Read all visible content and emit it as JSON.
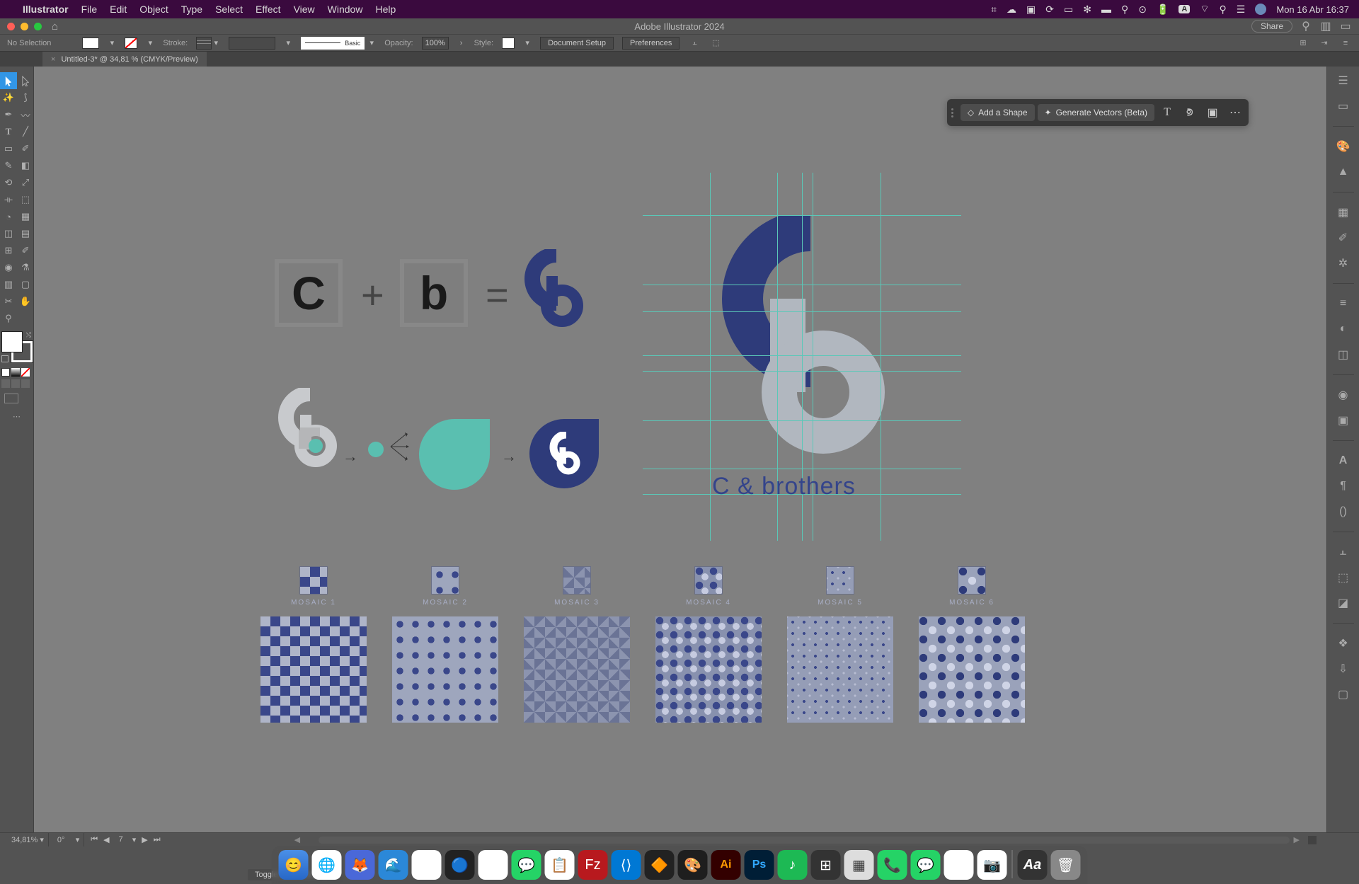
{
  "macos": {
    "app_name": "Illustrator",
    "menus": [
      "File",
      "Edit",
      "Object",
      "Type",
      "Select",
      "Effect",
      "View",
      "Window",
      "Help"
    ],
    "clock": "Mon 16 Abr  16:37"
  },
  "window": {
    "title": "Adobe Illustrator 2024",
    "share_label": "Share"
  },
  "control": {
    "selection_status": "No Selection",
    "stroke_label": "Stroke:",
    "brush_label": "Basic",
    "opacity_label": "Opacity:",
    "opacity_value": "100%",
    "style_label": "Style:",
    "docsetup_btn": "Document Setup",
    "prefs_btn": "Preferences"
  },
  "doctab": {
    "name": "Untitled-3* @ 34,81 % (CMYK/Preview)"
  },
  "ctxbar": {
    "add_shape": "Add a Shape",
    "gen_vectors": "Generate Vectors (Beta)"
  },
  "status": {
    "zoom": "34,81%",
    "rotation": "0°",
    "artboard": "7",
    "tooltip": "Toggle Direct Selection"
  },
  "artwork": {
    "letter_c": "C",
    "letter_b": "b",
    "plus": "+",
    "equals": "=",
    "brand": "C & brothers",
    "mosaics": [
      "MOSAIC 1",
      "MOSAIC 2",
      "MOSAIC 3",
      "MOSAIC 4",
      "MOSAIC 5",
      "MOSAIC 6"
    ]
  },
  "colors": {
    "navy": "#2e3b7a",
    "teal": "#5abfb0",
    "lightgray": "#b1b7bf"
  }
}
